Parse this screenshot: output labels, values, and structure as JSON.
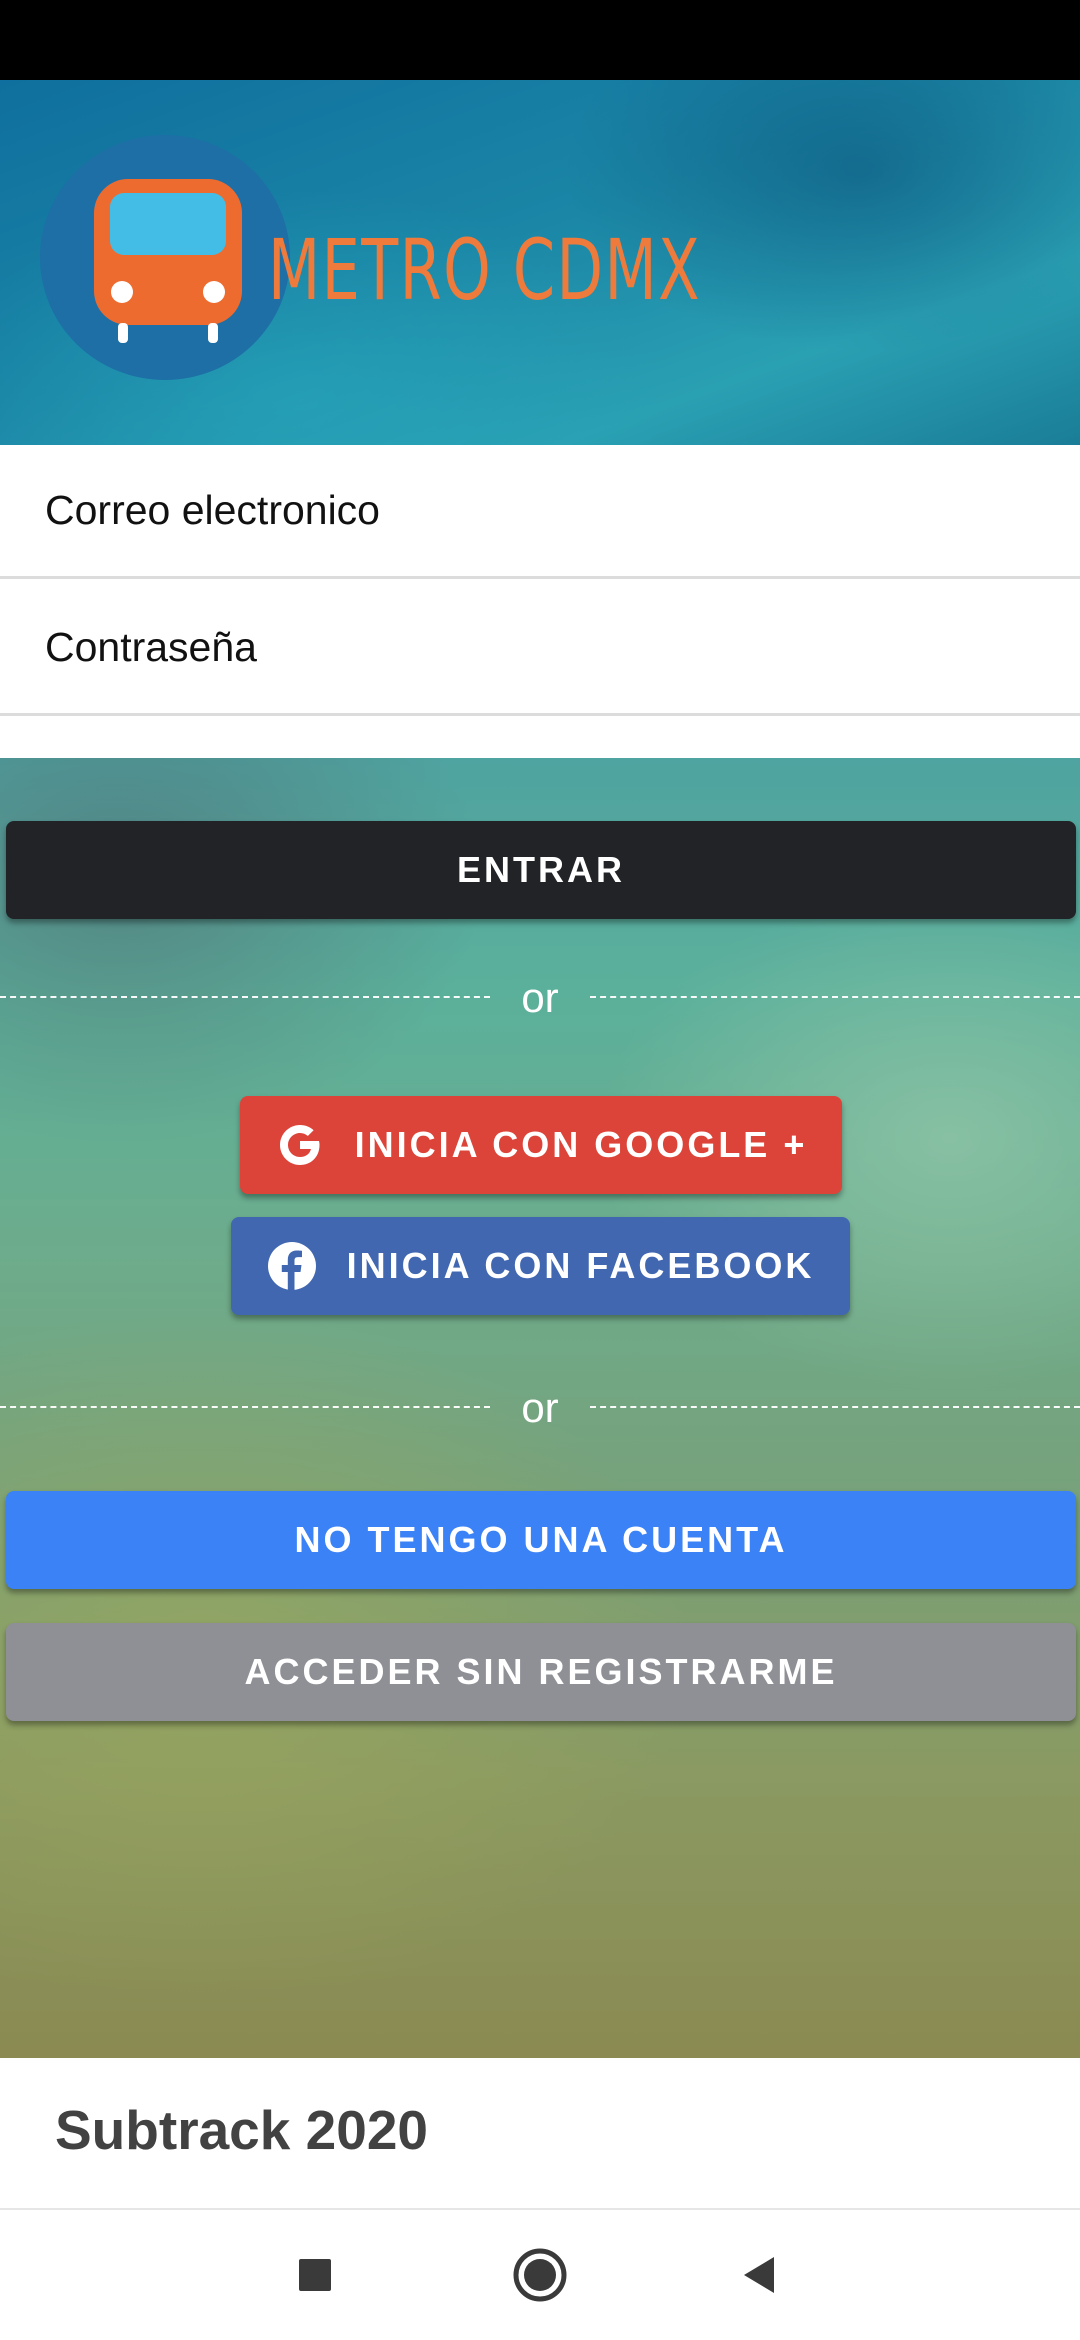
{
  "header": {
    "logo_text": "METRO CDMX"
  },
  "form": {
    "email_placeholder": "Correo electronico",
    "password_placeholder": "Contraseña"
  },
  "buttons": {
    "login": "ENTRAR",
    "google": "INICIA CON GOOGLE +",
    "facebook": "INICIA CON FACEBOOK",
    "register": "NO TENGO UNA CUENTA",
    "guest": "ACCEDER SIN REGISTRARME"
  },
  "dividers": {
    "first": "or",
    "second": "or"
  },
  "footer": {
    "text": "Subtrack 2020"
  },
  "colors": {
    "login_bg": "#222327",
    "google_bg": "#dd4439",
    "facebook_bg": "#4167b1",
    "register_bg": "#3b82f6",
    "guest_bg": "#8e9095",
    "logo_text": "#ee7a3c"
  },
  "icons": {
    "logo": "bus-icon",
    "google": "google-icon",
    "facebook": "facebook-icon",
    "nav_recents": "recents-square-icon",
    "nav_home": "home-circle-icon",
    "nav_back": "back-triangle-icon"
  }
}
